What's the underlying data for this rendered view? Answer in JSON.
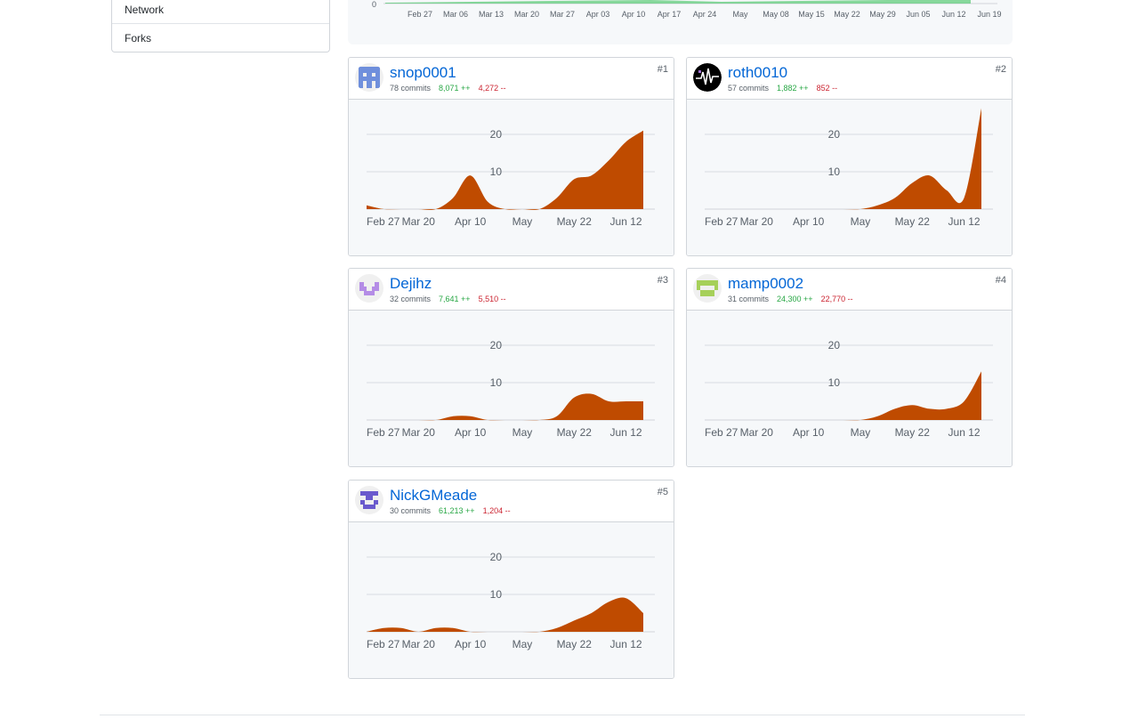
{
  "sidebar": {
    "items": [
      {
        "label": "Network"
      },
      {
        "label": "Forks"
      }
    ]
  },
  "overview_chart": {
    "zero_label": "0",
    "ticks": [
      "Feb 27",
      "Mar 06",
      "Mar 13",
      "Mar 20",
      "Mar 27",
      "Apr 03",
      "Apr 10",
      "Apr 17",
      "Apr 24",
      "May",
      "May 08",
      "May 15",
      "May 22",
      "May 29",
      "Jun 05",
      "Jun 12",
      "Jun 19"
    ],
    "color": "#2cbe4e"
  },
  "contributors": [
    {
      "rank": "#1",
      "name": "snop0001",
      "commits": "78 commits",
      "additions": "8,071 ++",
      "deletions": "4,272 --",
      "avatar_icon": "identicon-blue-icon",
      "avatar_color": "#6f8fdc"
    },
    {
      "rank": "#2",
      "name": "roth0010",
      "commits": "57 commits",
      "additions": "1,882 ++",
      "deletions": "852 --",
      "avatar_icon": "heartbeat-avatar-icon",
      "avatar_color": "#000000"
    },
    {
      "rank": "#3",
      "name": "Dejihz",
      "commits": "32 commits",
      "additions": "7,641 ++",
      "deletions": "5,510 --",
      "avatar_icon": "identicon-purple-icon",
      "avatar_color": "#b48ce6"
    },
    {
      "rank": "#4",
      "name": "mamp0002",
      "commits": "31 commits",
      "additions": "24,300 ++",
      "deletions": "22,770 --",
      "avatar_icon": "identicon-green-icon",
      "avatar_color": "#a6d05a"
    },
    {
      "rank": "#5",
      "name": "NickGMeade",
      "commits": "30 commits",
      "additions": "61,213 ++",
      "deletions": "1,204 --",
      "avatar_icon": "identicon-indigo-icon",
      "avatar_color": "#6a5acd"
    }
  ],
  "chart_data": [
    {
      "type": "area",
      "series": [
        {
          "name": "snop0001",
          "x": [
            "Feb 27",
            "Mar 06",
            "Mar 13",
            "Mar 20",
            "Mar 27",
            "Apr 03",
            "Apr 10",
            "Apr 17",
            "Apr 24",
            "May",
            "May 08",
            "May 15",
            "May 22",
            "May 29",
            "Jun 05",
            "Jun 12",
            "Jun 19"
          ],
          "values": [
            1,
            0,
            0,
            0,
            0,
            3,
            9,
            2,
            0,
            0,
            0,
            3,
            8,
            9,
            13,
            18,
            21
          ]
        }
      ],
      "yticks": [
        10,
        20
      ],
      "ylim": [
        0,
        25
      ],
      "xticks": [
        "Feb 27",
        "Mar 20",
        "Apr 10",
        "May",
        "May 22",
        "Jun 12"
      ],
      "color": "#bf4b00"
    },
    {
      "type": "area",
      "series": [
        {
          "name": "roth0010",
          "x": [
            "Feb 27",
            "Mar 06",
            "Mar 13",
            "Mar 20",
            "Mar 27",
            "Apr 03",
            "Apr 10",
            "Apr 17",
            "Apr 24",
            "May",
            "May 08",
            "May 15",
            "May 22",
            "May 29",
            "Jun 05",
            "Jun 12",
            "Jun 19"
          ],
          "values": [
            0,
            0,
            0,
            0,
            0,
            0,
            0,
            0,
            0,
            0,
            1,
            3,
            7,
            9,
            5,
            3,
            27
          ]
        }
      ],
      "yticks": [
        10,
        20
      ],
      "ylim": [
        0,
        25
      ],
      "xticks": [
        "Feb 27",
        "Mar 20",
        "Apr 10",
        "May",
        "May 22",
        "Jun 12"
      ],
      "color": "#bf4b00"
    },
    {
      "type": "area",
      "series": [
        {
          "name": "Dejihz",
          "x": [
            "Feb 27",
            "Mar 06",
            "Mar 13",
            "Mar 20",
            "Mar 27",
            "Apr 03",
            "Apr 10",
            "Apr 17",
            "Apr 24",
            "May",
            "May 08",
            "May 15",
            "May 22",
            "May 29",
            "Jun 05",
            "Jun 12",
            "Jun 19"
          ],
          "values": [
            0,
            0,
            0,
            0,
            0,
            1,
            1,
            0,
            0,
            0,
            0,
            1,
            6,
            7,
            5,
            5,
            5
          ]
        }
      ],
      "yticks": [
        10,
        20
      ],
      "ylim": [
        0,
        25
      ],
      "xticks": [
        "Feb 27",
        "Mar 20",
        "Apr 10",
        "May",
        "May 22",
        "Jun 12"
      ],
      "color": "#bf4b00"
    },
    {
      "type": "area",
      "series": [
        {
          "name": "mamp0002",
          "x": [
            "Feb 27",
            "Mar 06",
            "Mar 13",
            "Mar 20",
            "Mar 27",
            "Apr 03",
            "Apr 10",
            "Apr 17",
            "Apr 24",
            "May",
            "May 08",
            "May 15",
            "May 22",
            "May 29",
            "Jun 05",
            "Jun 12",
            "Jun 19"
          ],
          "values": [
            0,
            0,
            0,
            0,
            0,
            0,
            0,
            0,
            0,
            0,
            1,
            3,
            4,
            3,
            3,
            5,
            13
          ]
        }
      ],
      "yticks": [
        10,
        20
      ],
      "ylim": [
        0,
        25
      ],
      "xticks": [
        "Feb 27",
        "Mar 20",
        "Apr 10",
        "May",
        "May 22",
        "Jun 12"
      ],
      "color": "#bf4b00"
    },
    {
      "type": "area",
      "series": [
        {
          "name": "NickGMeade",
          "x": [
            "Feb 27",
            "Mar 06",
            "Mar 13",
            "Mar 20",
            "Mar 27",
            "Apr 03",
            "Apr 10",
            "Apr 17",
            "Apr 24",
            "May",
            "May 08",
            "May 15",
            "May 22",
            "May 29",
            "Jun 05",
            "Jun 12",
            "Jun 19"
          ],
          "values": [
            0,
            1,
            1,
            0,
            1,
            1,
            0,
            0,
            0,
            0,
            0,
            1,
            3,
            5,
            8,
            9,
            5
          ]
        }
      ],
      "yticks": [
        10,
        20
      ],
      "ylim": [
        0,
        25
      ],
      "xticks": [
        "Feb 27",
        "Mar 20",
        "Apr 10",
        "May",
        "May 22",
        "Jun 12"
      ],
      "color": "#bf4b00"
    }
  ]
}
